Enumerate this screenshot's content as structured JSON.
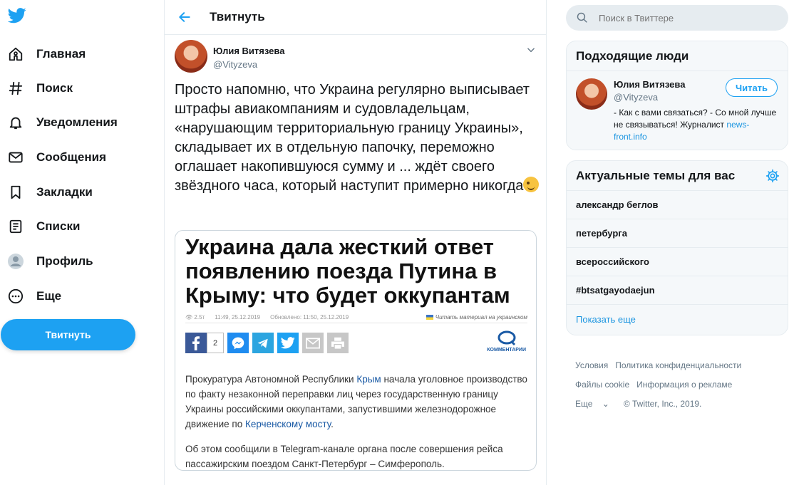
{
  "colors": {
    "accent": "#1da1f2",
    "border": "#e6ecf0",
    "text": "#14171a",
    "muted": "#657786",
    "link": "#1b95e0"
  },
  "nav": {
    "logo_icon": "twitter-bird-icon",
    "items": [
      {
        "label": "Главная",
        "icon": "home-icon"
      },
      {
        "label": "Поиск",
        "icon": "hashtag-icon"
      },
      {
        "label": "Уведомления",
        "icon": "bell-icon"
      },
      {
        "label": "Сообщения",
        "icon": "envelope-icon"
      },
      {
        "label": "Закладки",
        "icon": "bookmark-icon"
      },
      {
        "label": "Списки",
        "icon": "list-icon"
      },
      {
        "label": "Профиль",
        "icon": "profile-icon"
      },
      {
        "label": "Еще",
        "icon": "more-icon"
      }
    ],
    "tweet_button": "Твитнуть"
  },
  "center": {
    "title": "Твитнуть",
    "author": {
      "name": "Юлия Витязева",
      "handle": "@Vityzeva"
    },
    "tweet_text": "Просто напомню, что Украина регулярно выписывает штрафы авиакомпаниям и судовладельцам, «нарушающим территориальную границу Украины», складывает их в отдельную папочку, переможно оглашает накопившуюся сумму и ... ждёт своего звёздного часа, который наступит примерно никогда",
    "media": {
      "headline": "Украина дала жесткий ответ появлению поезда Путина в Крыму: что будет оккупантам",
      "views": "2.5т",
      "published": "11:49, 25.12.2019",
      "updated": "Обновлено: 11:50, 25.12.2019",
      "read_ua": "Читать материал на украинском",
      "fb_count": "2",
      "comments_label": "КОММЕНТАРИИ",
      "para1_a": "Прокуратура Автономной Республики ",
      "para1_link1": "Крым",
      "para1_b": " начала уголовное производство по факту незаконной переправки лиц через государственную границу Украины российскими оккупантами, запустившими железнодорожное движение по ",
      "para1_link2": "Керченскому мосту",
      "para1_c": ".",
      "para2": "Об этом сообщили в Telegram-канале органа после совершения рейса пассажирским поездом Санкт-Петербург – Симферополь."
    }
  },
  "right": {
    "search_placeholder": "Поиск в Твиттере",
    "people": {
      "title": "Подходящие люди",
      "name": "Юлия Витязева",
      "handle": "@Vityzeva",
      "follow": "Читать",
      "bio": "- Как с вами связаться? - Со мной лучше не связываться! Журналист ",
      "bio_link": "news-front.info"
    },
    "trends": {
      "title": "Актуальные темы для вас",
      "items": [
        "александр беглов",
        "петербурга",
        "всероссийского",
        "#btsatgayodaejun"
      ],
      "show_more": "Показать еще"
    },
    "footer": {
      "terms": "Условия",
      "privacy": "Политика конфиденциальности",
      "cookies": "Файлы cookie",
      "ads": "Информация о рекламе",
      "more": "Еще",
      "copyright": "© Twitter, Inc., 2019."
    }
  }
}
